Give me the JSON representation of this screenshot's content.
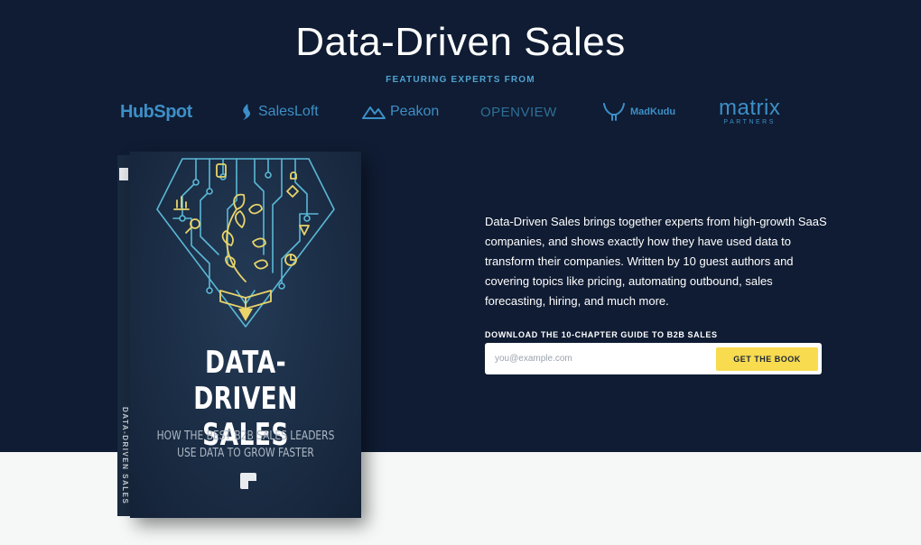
{
  "hero": {
    "title": "Data-Driven Sales",
    "featuring_label": "FEATURING EXPERTS FROM",
    "background": "#0f1c33"
  },
  "logos": {
    "hubspot": "HubSpot",
    "salesloft": "SalesLoft",
    "peakon": "Peakon",
    "openview": "OPENVIEW",
    "madkudu": "MadKudu",
    "matrix_main": "matrix",
    "matrix_sub": "PARTNERS",
    "color": "#3d8fc7"
  },
  "book": {
    "spine_text": "DATA-DRIVEN SALES",
    "title_line1": "DATA-DRIVEN",
    "title_line2": "SALES",
    "subtitle_line1": "HOW THE BEST B2B SALES LEADERS",
    "subtitle_line2": "USE DATA TO GROW FASTER"
  },
  "description": "Data-Driven Sales brings together experts from high-growth SaaS companies, and shows exactly how they have used data to transform their companies. Written by 10 guest authors and covering topics like pricing, automating outbound, sales forecasting, hiring, and much more.",
  "download": {
    "label": "DOWNLOAD THE 10-CHAPTER GUIDE TO B2B SALES",
    "email_placeholder": "you@example.com",
    "email_value": "",
    "button_label": "GET THE BOOK",
    "button_color": "#f8db4e"
  }
}
